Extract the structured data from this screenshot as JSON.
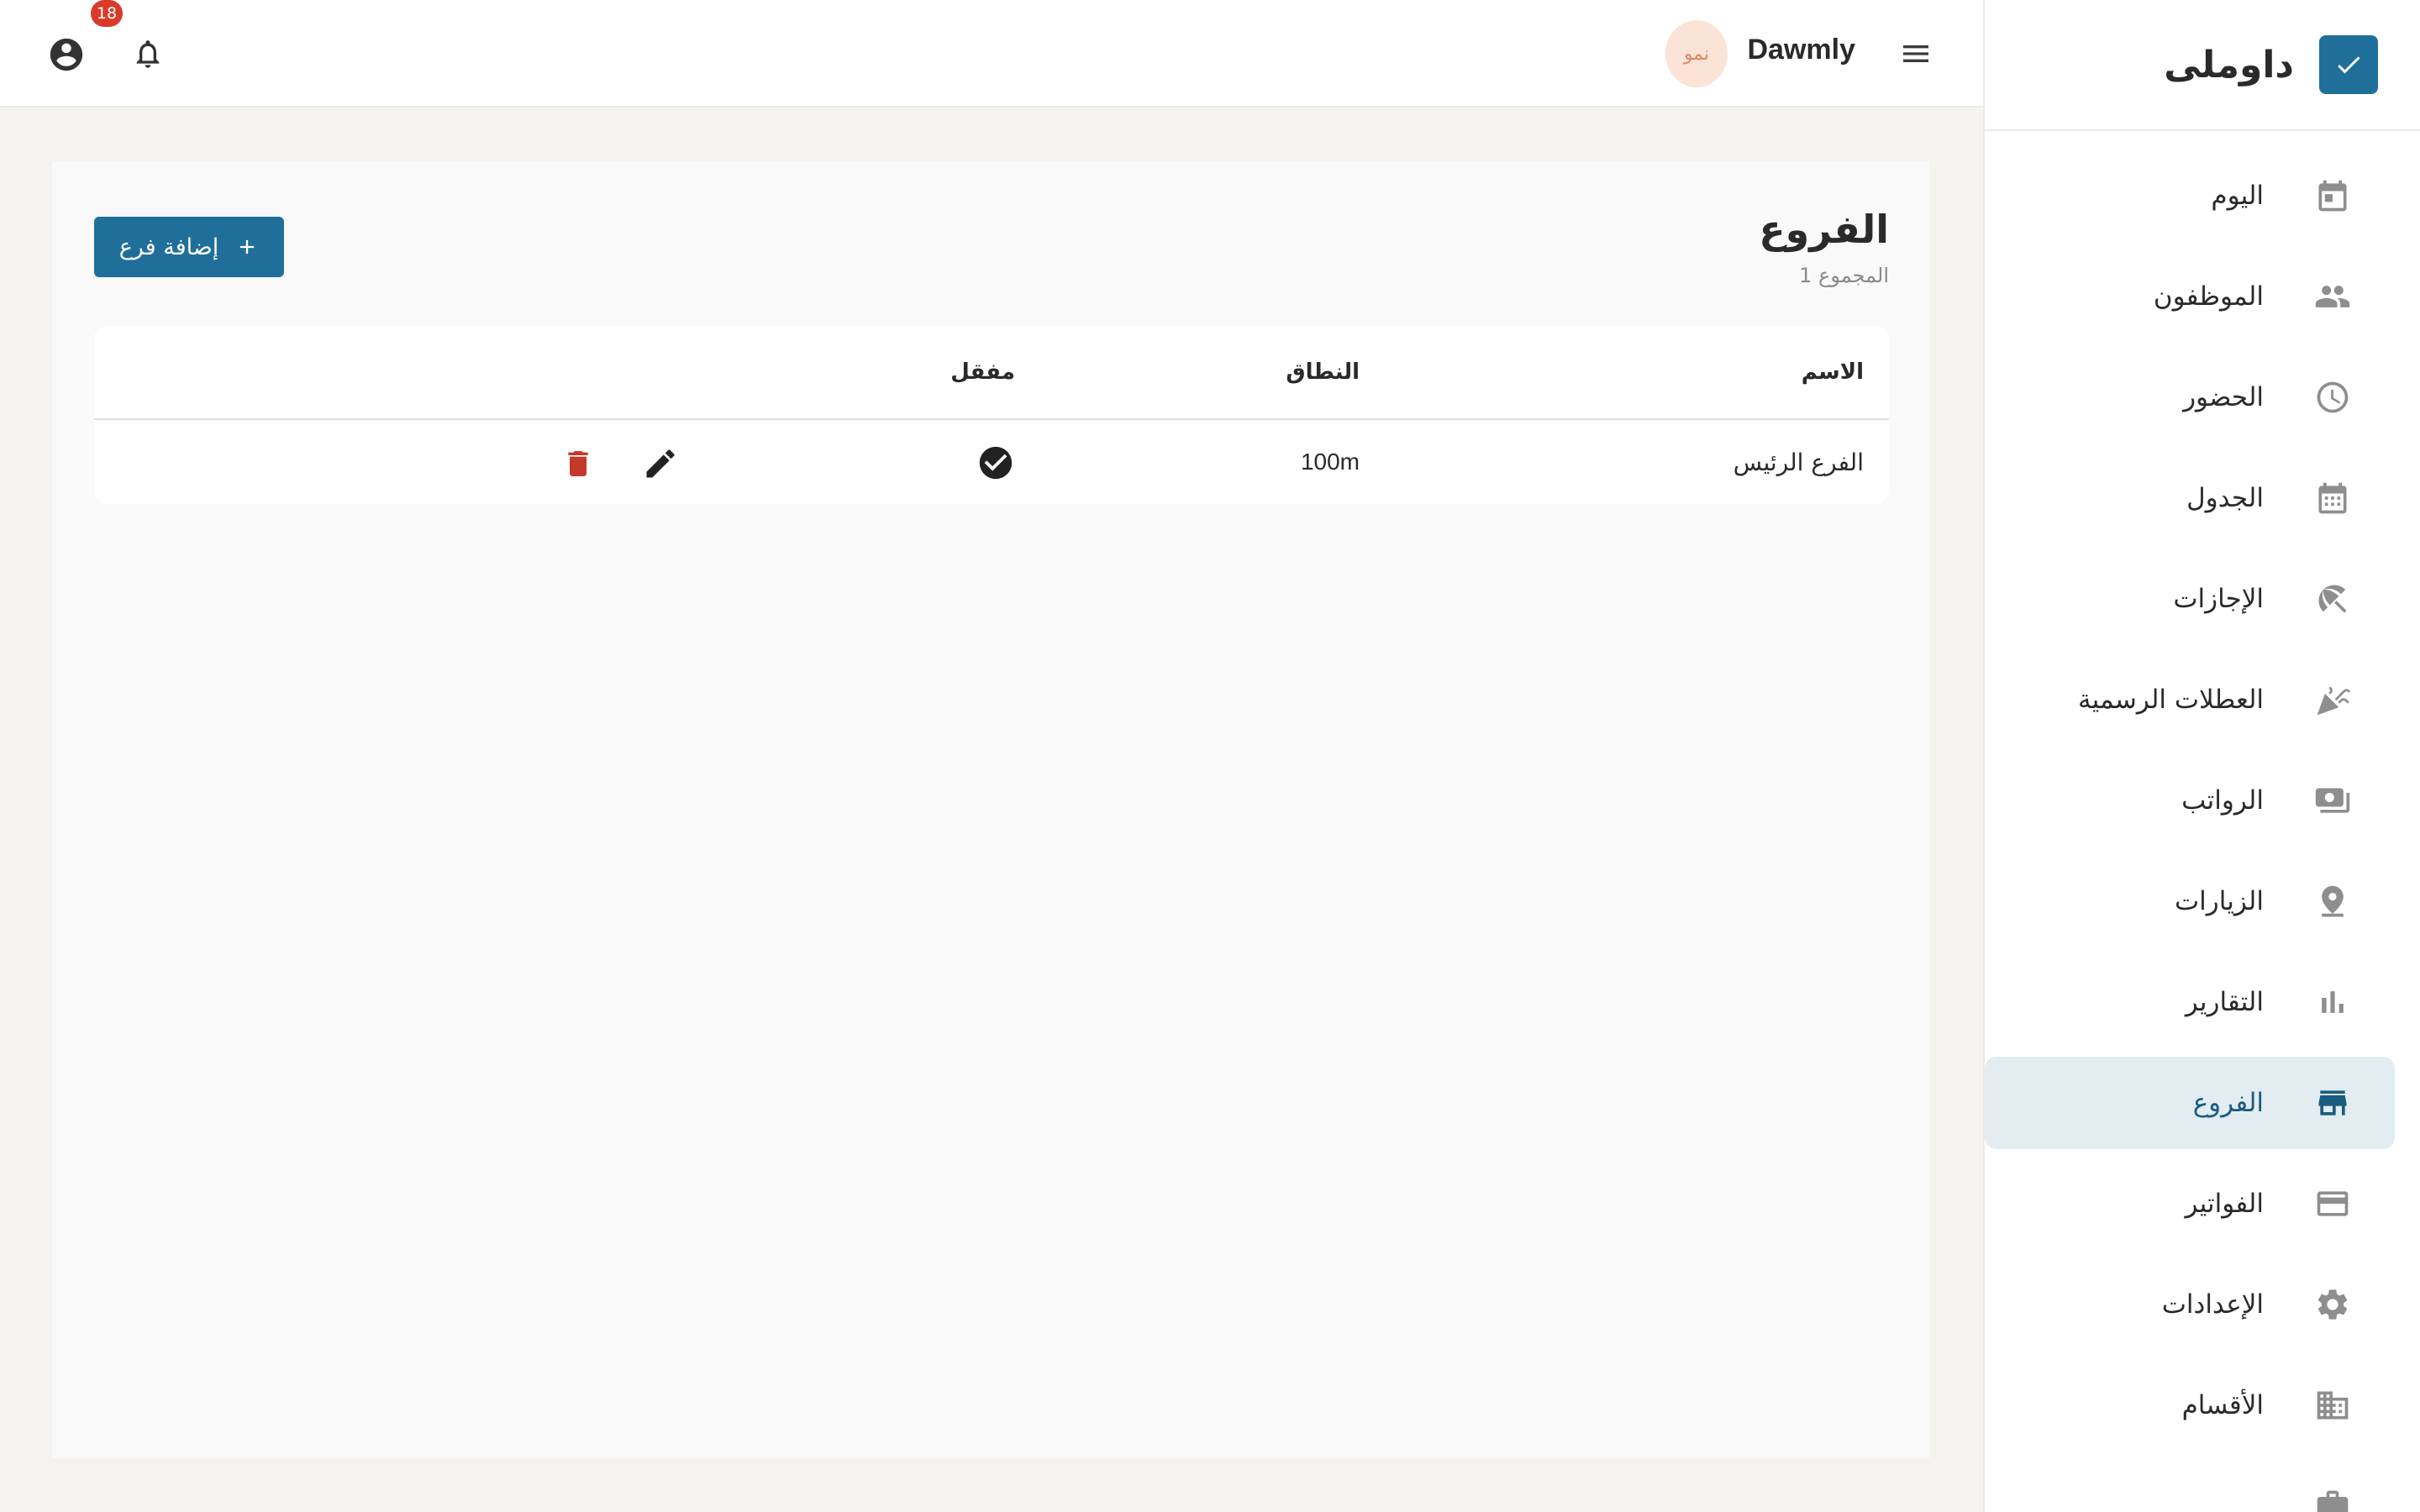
{
  "brand": {
    "name": "داوملى",
    "accent": "#1f6f9a"
  },
  "header": {
    "user_name": "Dawmly",
    "avatar_text": "نمو",
    "notification_count": "18"
  },
  "sidebar": {
    "items": [
      {
        "label": "اليوم",
        "icon": "calendar-today-icon"
      },
      {
        "label": "الموظفون",
        "icon": "people-icon"
      },
      {
        "label": "الحضور",
        "icon": "clock-icon"
      },
      {
        "label": "الجدول",
        "icon": "calendar-grid-icon"
      },
      {
        "label": "الإجازات",
        "icon": "beach-umbrella-icon"
      },
      {
        "label": "العطلات الرسمية",
        "icon": "celebration-icon"
      },
      {
        "label": "الرواتب",
        "icon": "payments-icon"
      },
      {
        "label": "الزيارات",
        "icon": "location-pin-icon"
      },
      {
        "label": "التقارير",
        "icon": "bar-chart-icon"
      },
      {
        "label": "الفروع",
        "icon": "store-icon",
        "active": true
      },
      {
        "label": "الفواتير",
        "icon": "credit-card-icon"
      },
      {
        "label": "الإعدادات",
        "icon": "gear-icon"
      },
      {
        "label": "الأقسام",
        "icon": "building-icon"
      },
      {
        "label": "",
        "icon": "briefcase-icon"
      }
    ]
  },
  "main": {
    "title": "الفروع",
    "subtitle": "1 المجموع",
    "add_button_label": "إضافة فرع",
    "table": {
      "headers": {
        "name": "الاسم",
        "range": "النطاق",
        "locked": "مفقل"
      },
      "rows": [
        {
          "name": "الفرع الرئيس",
          "range": "100m",
          "locked": true
        }
      ]
    }
  }
}
